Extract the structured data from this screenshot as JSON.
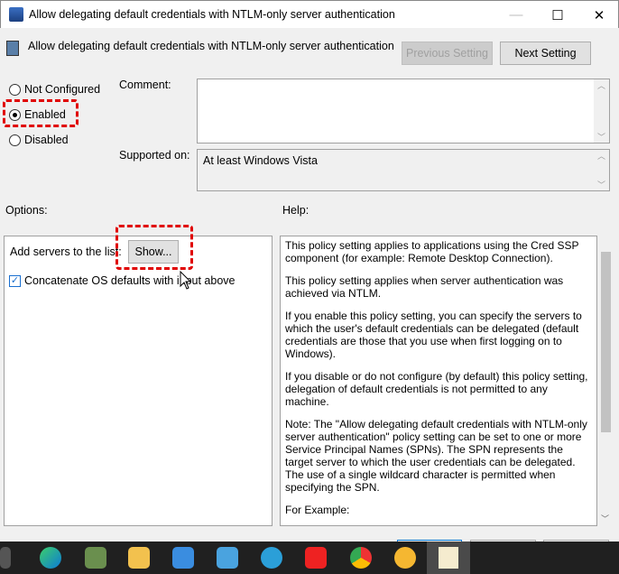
{
  "window": {
    "title": "Allow delegating default credentials with NTLM-only server authentication",
    "minimize": "—",
    "maximize": "☐",
    "close": "✕"
  },
  "header": {
    "setting_name": "Allow delegating default credentials with NTLM-only server authentication",
    "previous_label": "Previous Setting",
    "next_label": "Next Setting"
  },
  "state": {
    "options": [
      "Not Configured",
      "Enabled",
      "Disabled"
    ],
    "selected": "Enabled"
  },
  "comment": {
    "label": "Comment:",
    "value": ""
  },
  "supported": {
    "label": "Supported on:",
    "value": "At least Windows Vista"
  },
  "options_panel": {
    "label": "Options:",
    "add_servers_label": "Add servers to the list:",
    "show_button": "Show...",
    "concatenate_label": "Concatenate OS defaults with input above",
    "concatenate_checked": true
  },
  "help": {
    "label": "Help:",
    "paragraphs": [
      "This policy setting applies to applications using the Cred SSP component (for example: Remote Desktop Connection).",
      "This policy setting applies when server authentication was achieved via NTLM.",
      "If you enable this policy setting, you can specify the servers to which the user's default credentials can be delegated (default credentials are those that you use when first logging on to Windows).",
      "If you disable or do not configure (by default) this policy setting, delegation of default credentials is not permitted to any machine.",
      "Note: The \"Allow delegating default credentials with NTLM-only server authentication\" policy setting can be set to one or more Service Principal Names (SPNs). The SPN represents the target server to which the user credentials can be delegated.  The use of a single wildcard character is permitted when specifying the SPN.",
      "For Example:"
    ]
  },
  "taskbar": {
    "icons": [
      "task-view",
      "edge",
      "app",
      "file-explorer",
      "store",
      "photos",
      "app2",
      "wps",
      "chrome",
      "app3",
      "notepad"
    ]
  }
}
